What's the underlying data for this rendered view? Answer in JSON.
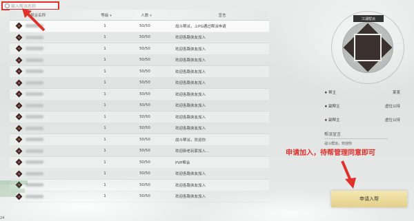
{
  "search": {
    "placeholder": "输入帮派名称"
  },
  "table": {
    "headers": {
      "name": "帮派名称",
      "level": "等级",
      "members": "人数",
      "declaration": "宣言"
    },
    "sort_indicator": "▾",
    "rows": [
      {
        "level": "1",
        "members": "50/50",
        "declaration": "战斗帮派，上PG通过帮派申请"
      },
      {
        "level": "1",
        "members": "50/50",
        "declaration": "欢迎各路侠友加入"
      },
      {
        "level": "1",
        "members": "50/50",
        "declaration": "欢迎各路侠友加入"
      },
      {
        "level": "1",
        "members": "50/50",
        "declaration": "欢迎各路侠友加入"
      },
      {
        "level": "1",
        "members": "50/50",
        "declaration": "欢迎各路侠友加入"
      },
      {
        "level": "1",
        "members": "50/50",
        "declaration": "欢迎各路侠友加入"
      },
      {
        "level": "1",
        "members": "50/50",
        "declaration": "欢迎各路侠友加入"
      },
      {
        "level": "1",
        "members": "50/50",
        "declaration": "欢迎各路侠友加入"
      },
      {
        "level": "1",
        "members": "50/50",
        "declaration": "欢迎各路侠友加入"
      },
      {
        "level": "1",
        "members": "50/50",
        "declaration": "欢迎各路侠友加入"
      },
      {
        "level": "1",
        "members": "50/50",
        "declaration": "战斗帮派，欢迎你"
      },
      {
        "level": "1",
        "members": "50/50",
        "declaration": "欢迎新老玩家加入…"
      },
      {
        "level": "1",
        "members": "50/50",
        "declaration": "PVP帮会"
      },
      {
        "level": "1",
        "members": "50/50",
        "declaration": "欢迎各路侠友加入"
      },
      {
        "level": "1",
        "members": "50/50",
        "declaration": "欢迎各路侠友加入"
      },
      {
        "level": "1",
        "members": "50/50",
        "declaration": "欢迎各路侠友加入"
      }
    ]
  },
  "panel": {
    "banner": "江湖帮派",
    "leader_label": "帮主",
    "leader_value": "某某",
    "vice1_label": "副帮主",
    "vice1_value": "虚位以待",
    "vice2_label": "副帮主",
    "vice2_value": "虚位以待",
    "declaration_heading": "帮派宣言",
    "declaration_text": "战斗帮派，欢迎你"
  },
  "annotation": {
    "text": "申请加入，待帮管理同意即可"
  },
  "apply_button": {
    "label": "申请入帮"
  },
  "corner_text": "24",
  "colors": {
    "highlight_red": "#e0302a",
    "button_gold": "#e4d08a",
    "emblem_dark": "#2e2624"
  }
}
